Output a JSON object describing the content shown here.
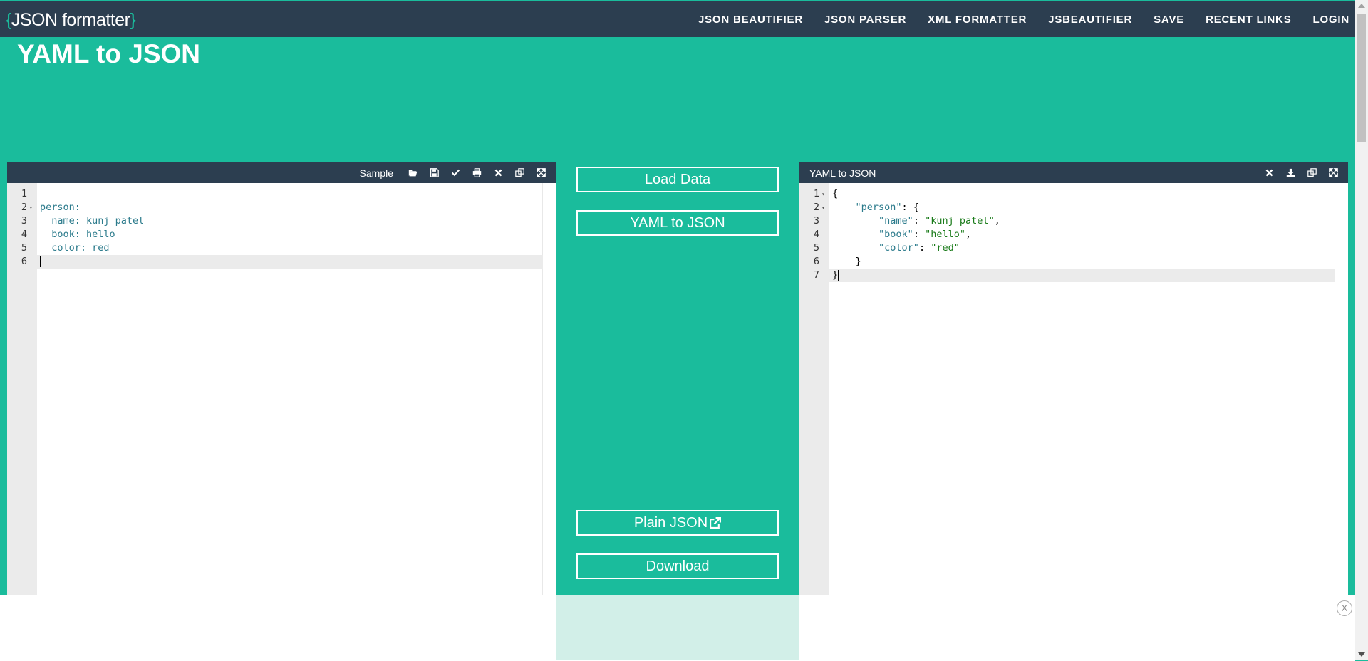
{
  "header": {
    "logo_brace_open": "{",
    "logo_text": "JSON formatter",
    "logo_brace_close": "}",
    "nav": [
      "JSON BEAUTIFIER",
      "JSON PARSER",
      "XML FORMATTER",
      "JSBEAUTIFIER",
      "SAVE",
      "RECENT LINKS",
      "LOGIN"
    ]
  },
  "page_title": "YAML to JSON",
  "left_panel": {
    "sample_label": "Sample",
    "lines": [
      {
        "num": "1",
        "text": ""
      },
      {
        "num": "2",
        "text": "person:"
      },
      {
        "num": "3",
        "text": "  name: kunj patel"
      },
      {
        "num": "4",
        "text": "  book: hello"
      },
      {
        "num": "5",
        "text": "  color: red"
      },
      {
        "num": "6",
        "text": ""
      }
    ],
    "icons": [
      "folder-open-icon",
      "save-icon",
      "check-icon",
      "print-icon",
      "close-icon",
      "copy-icon",
      "expand-icon"
    ]
  },
  "middle": {
    "load_data": "Load Data",
    "yaml_to_json": "YAML to JSON",
    "plain_json": "Plain JSON",
    "download": "Download"
  },
  "right_panel": {
    "title": "YAML to JSON",
    "lines": [
      {
        "num": "1",
        "text": "{"
      },
      {
        "num": "2",
        "text": "    \"person\": {"
      },
      {
        "num": "3",
        "text": "        \"name\": \"kunj patel\","
      },
      {
        "num": "4",
        "text": "        \"book\": \"hello\","
      },
      {
        "num": "5",
        "text": "        \"color\": \"red\""
      },
      {
        "num": "6",
        "text": "    }"
      },
      {
        "num": "7",
        "text": "}"
      }
    ],
    "icons": [
      "close-icon",
      "download-icon",
      "copy-icon",
      "expand-icon"
    ]
  },
  "ad": {
    "close_label": "X"
  },
  "colors": {
    "accent": "#1abc9c",
    "header": "#2c3e50",
    "key": "#2c7b8c",
    "string": "#1a7b1a"
  }
}
